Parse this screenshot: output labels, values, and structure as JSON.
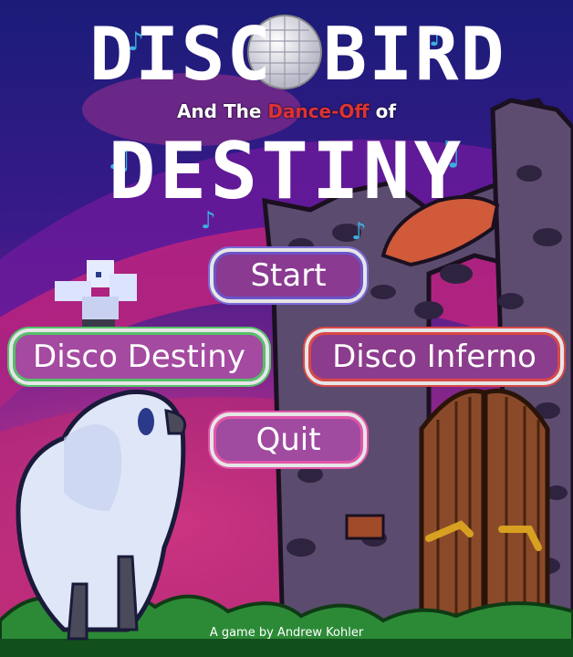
{
  "title": {
    "disco": "DISC",
    "bird": "BIRD",
    "subtitle_pre": "And The ",
    "subtitle_dance": "Dance-Off",
    "subtitle_post": " of",
    "destiny": "DESTINY"
  },
  "menu": {
    "start": "Start",
    "disco_destiny": "Disco Destiny",
    "disco_inferno": "Disco Inferno",
    "quit": "Quit"
  },
  "credit": "A game by Andrew Kohler",
  "colors": {
    "sky": "#1b1c7a",
    "pink": "#c8287a",
    "purple": "#5a1a8a",
    "ground": "#2a8a3a"
  }
}
